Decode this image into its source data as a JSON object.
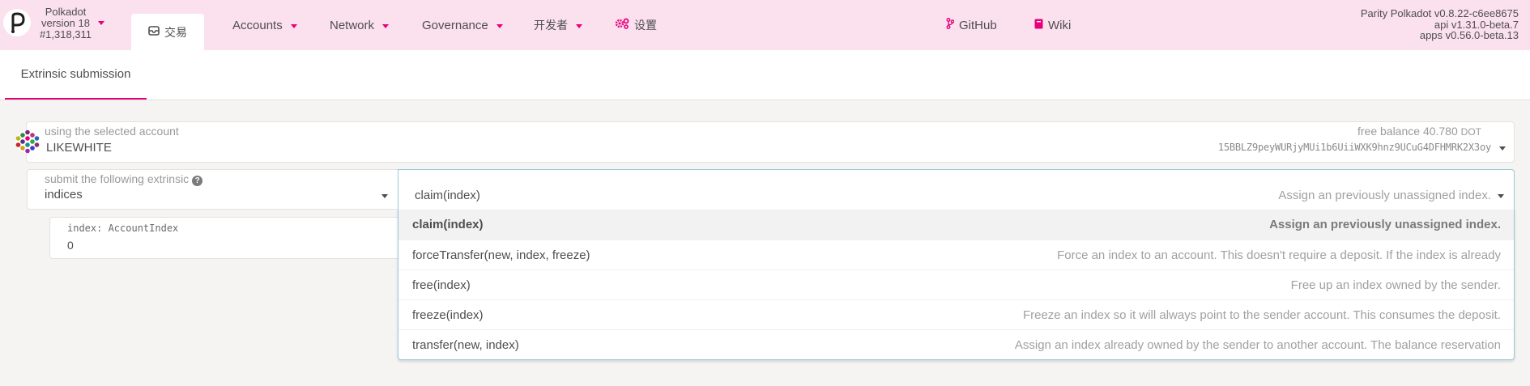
{
  "header": {
    "chain": {
      "name": "Polkadot",
      "version": "version 18",
      "block": "#1,318,311"
    },
    "nav": [
      {
        "label": "交易",
        "icon": "paper-plane-icon"
      },
      {
        "label": "Accounts"
      },
      {
        "label": "Network"
      },
      {
        "label": "Governance"
      },
      {
        "label": "开发者"
      },
      {
        "label": "设置",
        "icon": "cogs-icon"
      },
      {
        "label": "GitHub",
        "icon": "code-branch-icon"
      },
      {
        "label": "Wiki",
        "icon": "book-icon"
      }
    ],
    "version_info": [
      "Parity Polkadot v0.8.22-c6ee8675",
      "api v1.31.0-beta.7",
      "apps v0.56.0-beta.13"
    ]
  },
  "tabs": [
    {
      "label": "Extrinsic submission"
    }
  ],
  "account": {
    "label": "using the selected account",
    "name": "LIKEWHITE",
    "balance_label": "free balance",
    "balance_value": "40.780",
    "balance_unit": "DOT",
    "address": "15BBLZ9peyWURjyMUi1b6UiiWXK9hnz9UCuG4DFHMRK2X3oy"
  },
  "extrinsic": {
    "label": "submit the following extrinsic",
    "module": "indices",
    "method": "claim(index)",
    "method_desc": "Assign an previously unassigned index."
  },
  "param": {
    "label": "index: AccountIndex",
    "value": "0"
  },
  "options": [
    {
      "name": "claim(index)",
      "desc": "Assign an previously unassigned index."
    },
    {
      "name": "forceTransfer(new, index, freeze)",
      "desc": "Force an index to an account. This doesn't require a deposit. If the index is already"
    },
    {
      "name": "free(index)",
      "desc": "Free up an index owned by the sender."
    },
    {
      "name": "freeze(index)",
      "desc": "Freeze an index so it will always point to the sender account. This consumes the deposit."
    },
    {
      "name": "transfer(new, index)",
      "desc": "Assign an index already owned by the sender to another account. The balance reservation"
    }
  ],
  "colors": {
    "accent": "#e6007a",
    "header_bg": "#fbe0ee",
    "page_bg": "#f5f4f3",
    "focus_border": "#96c8da"
  }
}
